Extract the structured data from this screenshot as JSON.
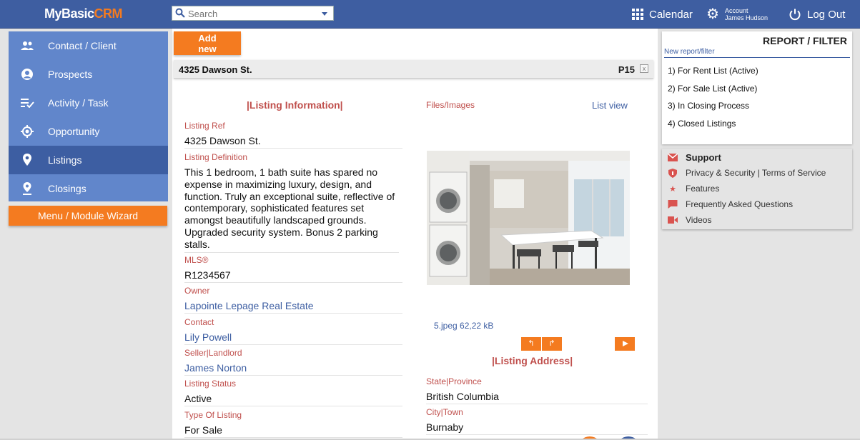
{
  "app": {
    "logo_main": "MyBasic",
    "logo_accent": "CRM"
  },
  "search": {
    "placeholder": "Search"
  },
  "topnav": {
    "calendar": "Calendar",
    "account_line1": "Account",
    "account_line2": "James Hudson",
    "logout": "Log Out"
  },
  "sidebar": {
    "items": [
      {
        "label": "Contact / Client",
        "icon": "people-icon"
      },
      {
        "label": "Prospects",
        "icon": "user-circle-icon"
      },
      {
        "label": "Activity / Task",
        "icon": "task-list-icon"
      },
      {
        "label": "Opportunity",
        "icon": "target-icon"
      },
      {
        "label": "Listings",
        "icon": "map-pin-icon",
        "active": true
      },
      {
        "label": "Closings",
        "icon": "pin-drop-icon"
      }
    ],
    "wizard": "Menu / Module Wizard"
  },
  "toolbar": {
    "add_new_line1": "Add",
    "add_new_line2": "new"
  },
  "record": {
    "title": "4325 Dawson St.",
    "page": "P15",
    "close": "x"
  },
  "listing": {
    "section_title": "|Listing Information|",
    "fields": [
      {
        "label": "Listing Ref",
        "value": "4325 Dawson St."
      },
      {
        "label": "Listing Definition",
        "value": "This 1 bedroom, 1 bath suite has spared no expense in maximizing luxury, design, and function. Truly an exceptional suite, reflective of contemporary, sophisticated features set amongst beautifully landscaped grounds. Upgraded security system. Bonus 2 parking stalls."
      },
      {
        "label": "MLS®",
        "value": "R1234567"
      },
      {
        "label": "Owner",
        "value": "Lapointe Lepage Real Estate"
      },
      {
        "label": "Contact",
        "value": "Lily Powell"
      },
      {
        "label": "Seller|Landlord",
        "value": "James Norton"
      },
      {
        "label": "Listing Status",
        "value": "Active"
      },
      {
        "label": "Type Of Listing",
        "value": "For Sale"
      }
    ]
  },
  "files": {
    "label": "Files/Images",
    "list_view": "List view",
    "file_info": "5.jpeg 62,22 kB",
    "prev": "↰",
    "next": "↱"
  },
  "address": {
    "section_title": "|Listing Address|",
    "fields": [
      {
        "label": "State|Province",
        "value": "British Columbia"
      },
      {
        "label": "City|Town",
        "value": "Burnaby"
      }
    ]
  },
  "report": {
    "title": "REPORT / FILTER",
    "new_report": "New report/filter",
    "items": [
      "1) For Rent List (Active)",
      "2) For Sale List (Active)",
      "3) In Closing Process",
      "4) Closed Listings"
    ]
  },
  "support": {
    "items": [
      {
        "label": "Support",
        "icon": "mail-icon"
      },
      {
        "label": "Privacy & Security | Terms of Service",
        "icon": "shield-icon"
      },
      {
        "label": "Features",
        "icon": "star-icon"
      },
      {
        "label": "Frequently Asked Questions",
        "icon": "chat-icon"
      },
      {
        "label": "Videos",
        "icon": "video-icon"
      }
    ]
  },
  "colors": {
    "brand_blue": "#3e5ea1",
    "accent_orange": "#f47b20",
    "label_red": "#c0504d"
  }
}
